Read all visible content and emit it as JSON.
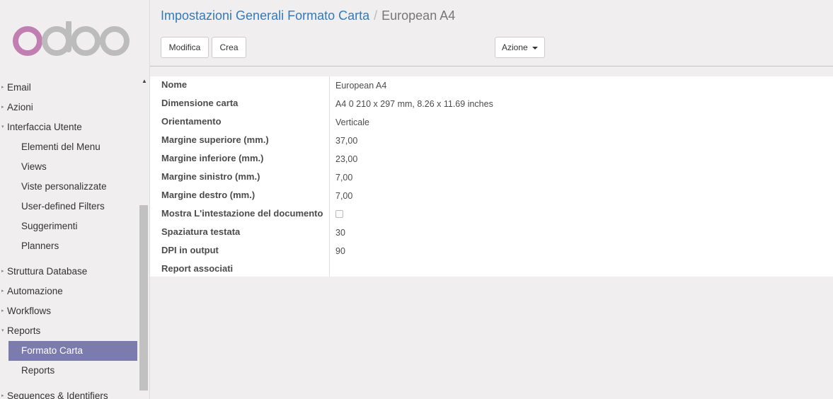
{
  "brand": {
    "logo_text": "odoo",
    "logo_colors": [
      "#c17fb1",
      "#bcbcbc"
    ],
    "accent": "#7c7bad",
    "link": "#337ab7"
  },
  "sidebar": {
    "items": [
      {
        "label": "Email",
        "level": 1,
        "collapsed": true
      },
      {
        "label": "Azioni",
        "level": 1,
        "collapsed": true
      },
      {
        "label": "Interfaccia Utente",
        "level": 1,
        "collapsed": false
      },
      {
        "label": "Elementi del Menu",
        "level": 2
      },
      {
        "label": "Views",
        "level": 2
      },
      {
        "label": "Viste personalizzate",
        "level": 2
      },
      {
        "label": "User-defined Filters",
        "level": 2
      },
      {
        "label": "Suggerimenti",
        "level": 2
      },
      {
        "label": "Planners",
        "level": 2
      },
      {
        "label": "Struttura Database",
        "level": 1,
        "collapsed": true
      },
      {
        "label": "Automazione",
        "level": 1,
        "collapsed": true
      },
      {
        "label": "Workflows",
        "level": 1,
        "collapsed": true
      },
      {
        "label": "Reports",
        "level": 1,
        "collapsed": false
      },
      {
        "label": "Formato Carta",
        "level": 2,
        "active": true
      },
      {
        "label": "Reports",
        "level": 2
      },
      {
        "label": "Sequences & Identifiers",
        "level": 1,
        "collapsed": true
      }
    ]
  },
  "breadcrumb": {
    "parent": "Impostazioni Generali Formato Carta",
    "separator": "/",
    "current": "European A4"
  },
  "toolbar": {
    "edit_label": "Modifica",
    "create_label": "Crea",
    "action_label": "Azione"
  },
  "form": {
    "fields": [
      {
        "label": "Nome",
        "value": "European A4"
      },
      {
        "label": "Dimensione carta",
        "value": "A4 0 210 x 297 mm, 8.26 x 11.69 inches"
      },
      {
        "label": "Orientamento",
        "value": "Verticale"
      },
      {
        "label": "Margine superiore (mm.)",
        "value": "37,00"
      },
      {
        "label": "Margine inferiore (mm.)",
        "value": "23,00"
      },
      {
        "label": "Margine sinistro (mm.)",
        "value": "7,00"
      },
      {
        "label": "Margine destro (mm.)",
        "value": "7,00"
      },
      {
        "label": "Mostra L'intestazione del documento",
        "type": "checkbox",
        "checked": false
      },
      {
        "label": "Spaziatura testata",
        "value": "30"
      },
      {
        "label": "DPI in output",
        "value": "90"
      },
      {
        "label": "Report associati",
        "value": ""
      }
    ]
  }
}
